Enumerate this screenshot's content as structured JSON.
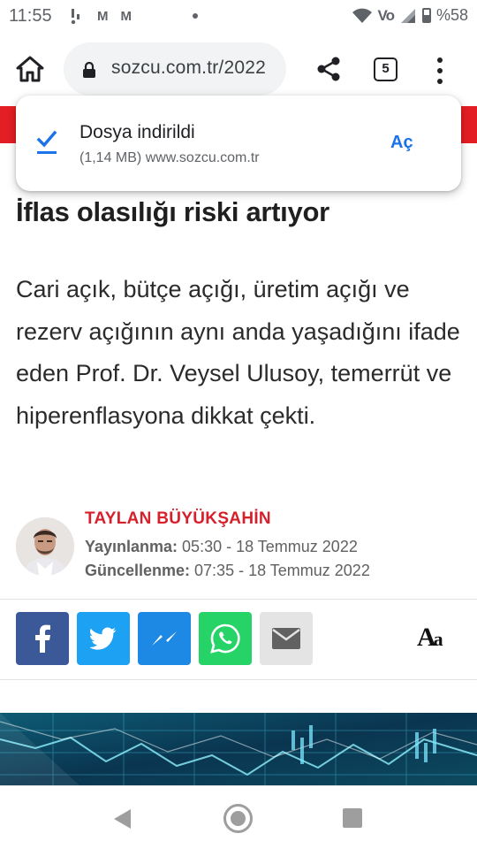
{
  "status_bar": {
    "time": "11:55",
    "left_icons": [
      "M",
      "M"
    ],
    "network_label": "Vo",
    "battery": "%58"
  },
  "browser": {
    "url": "sozcu.com.tr/2022",
    "tab_count": "5"
  },
  "download": {
    "title": "Dosya indirildi",
    "details": "(1,14 MB) www.sozcu.com.tr",
    "action": "Aç"
  },
  "article": {
    "headline": "İflas olasılığı riski artıyor",
    "summary": "Cari açık, bütçe açığı, üretim açığı ve rezerv açığının aynı anda yaşadığını ifade eden Prof. Dr. Veysel Ulusoy, temerrüt ve hiperenflasyona dikkat çekti.",
    "author": "TAYLAN BÜYÜKŞAHİN",
    "published_label": "Yayınlanma:",
    "published_value": " 05:30 - 18 Temmuz 2022",
    "updated_label": "Güncellenme:",
    "updated_value": " 07:35 - 18 Temmuz 2022"
  },
  "share": {
    "font_size_label_big": "A",
    "font_size_label_small": "a"
  },
  "colors": {
    "brand_red": "#e31e24",
    "author_red": "#d6202b",
    "facebook": "#3b5998",
    "twitter": "#1da1f2",
    "messenger": "#1e88e5",
    "whatsapp": "#25d366",
    "link_blue": "#1a73e8"
  },
  "icons": {
    "status": [
      "notification-icon",
      "gmail-icon",
      "gmail-icon",
      "wifi-icon",
      "volte-icon",
      "signal-icon",
      "battery-icon"
    ],
    "toolbar": [
      "home-icon",
      "lock-icon",
      "share-icon",
      "tabs-icon",
      "more-vert-icon"
    ],
    "share_buttons": [
      "facebook-icon",
      "twitter-icon",
      "messenger-icon",
      "whatsapp-icon",
      "email-icon"
    ],
    "nav": [
      "back-icon",
      "home-circle-icon",
      "recents-icon"
    ]
  }
}
